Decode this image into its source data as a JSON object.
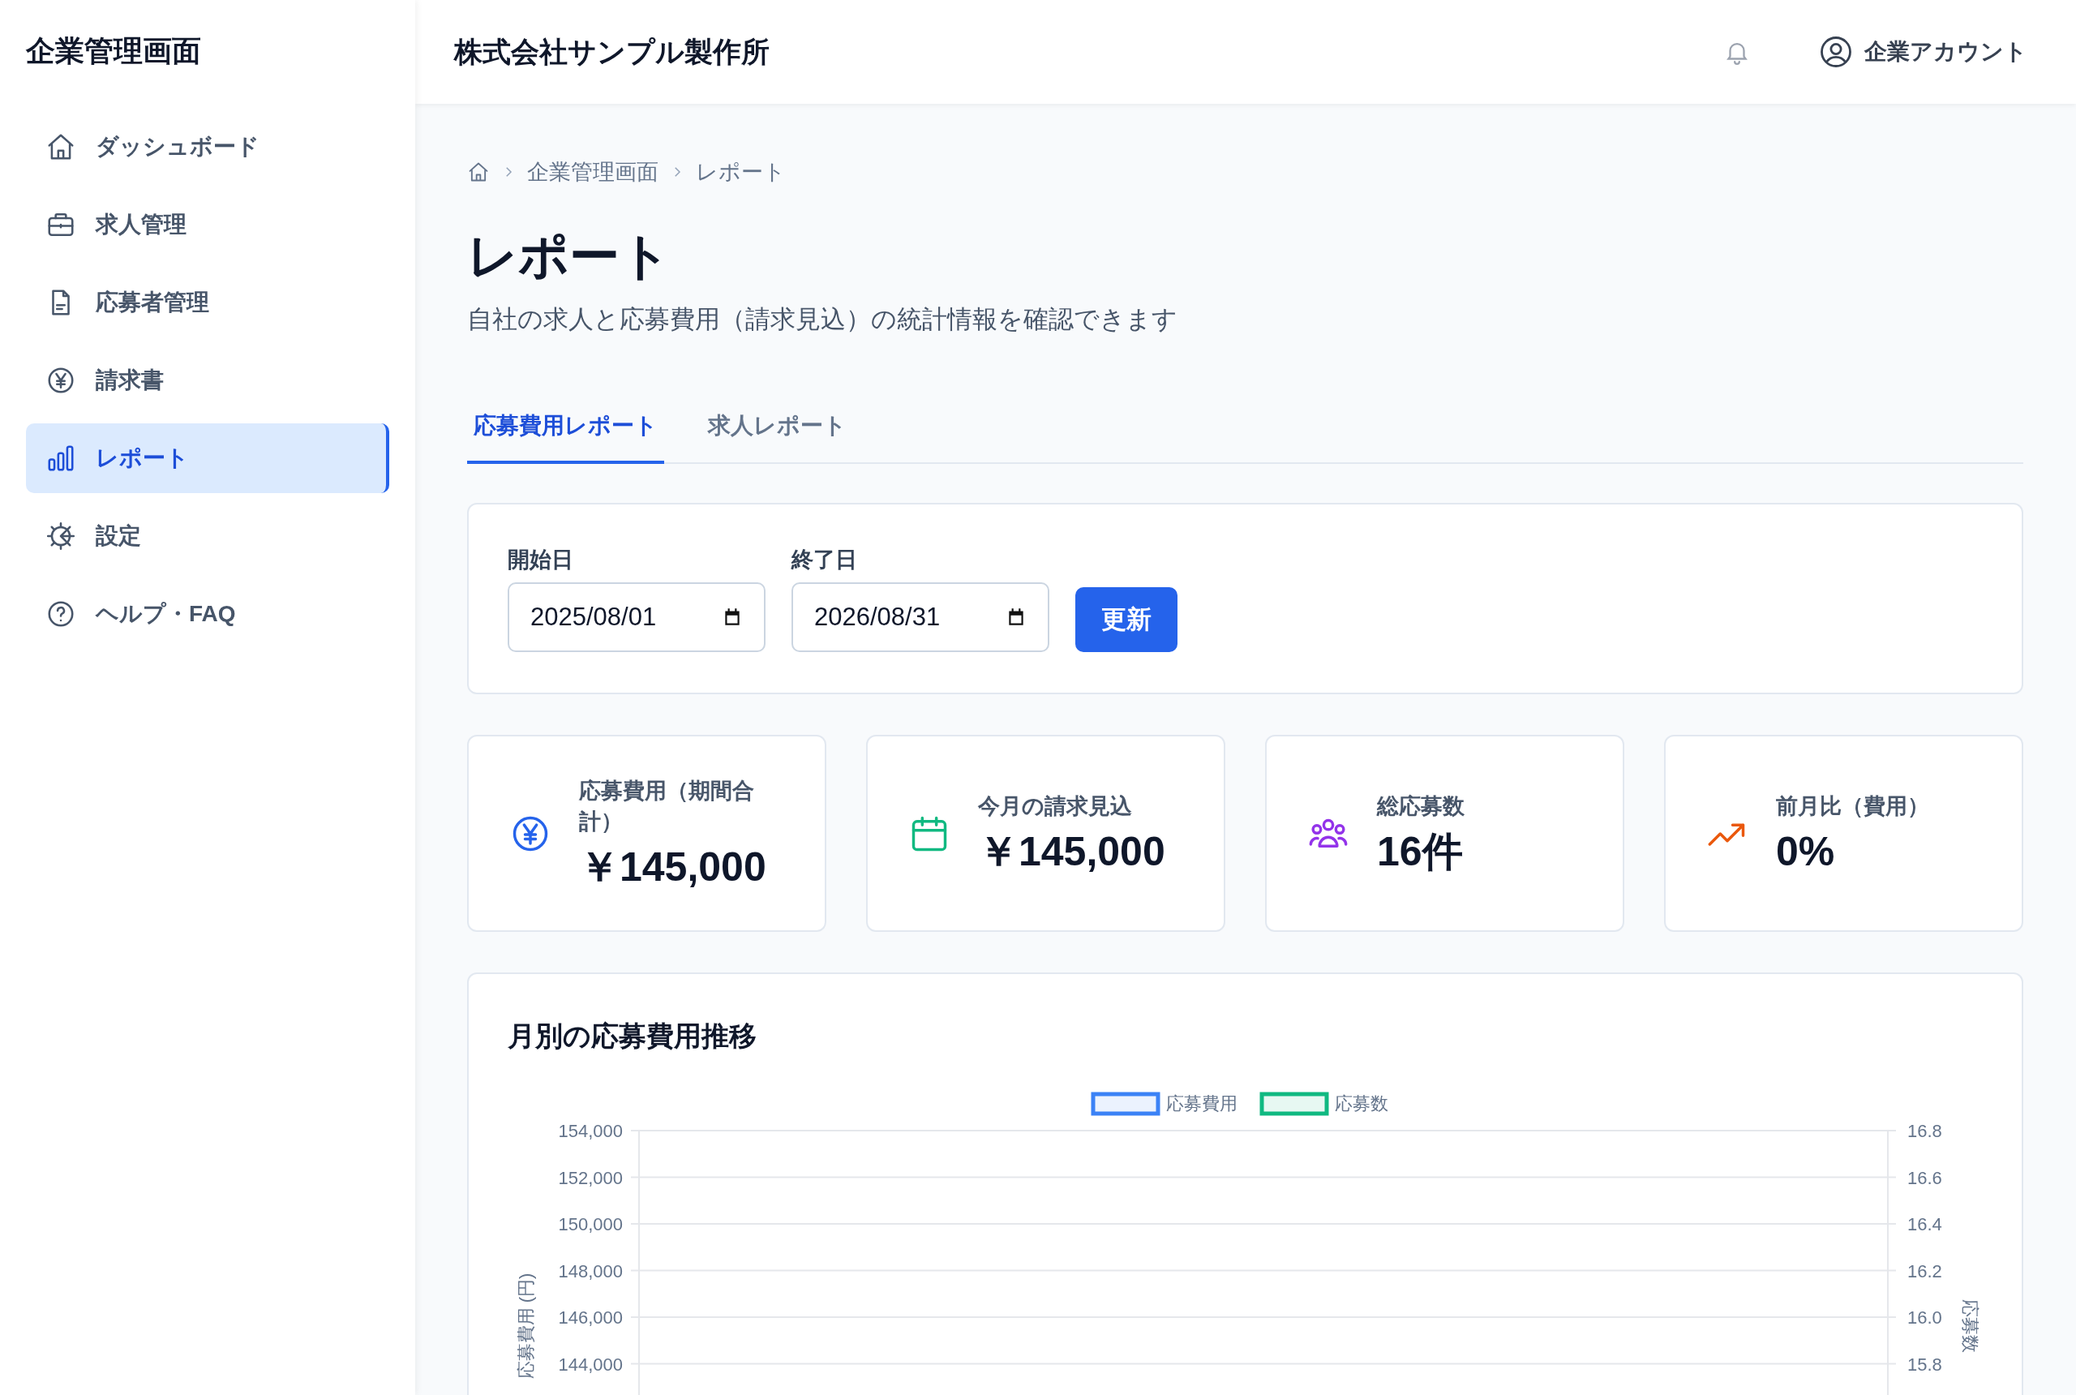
{
  "sidebar": {
    "title": "企業管理画面",
    "items": [
      {
        "label": "ダッシュボード",
        "selected": false
      },
      {
        "label": "求人管理",
        "selected": false
      },
      {
        "label": "応募者管理",
        "selected": false
      },
      {
        "label": "請求書",
        "selected": false
      },
      {
        "label": "レポート",
        "selected": true
      },
      {
        "label": "設定",
        "selected": false
      },
      {
        "label": "ヘルプ・FAQ",
        "selected": false
      }
    ]
  },
  "header": {
    "company": "株式会社サンプル製作所",
    "account": "企業アカウント"
  },
  "breadcrumb": [
    "企業管理画面",
    "レポート"
  ],
  "page": {
    "title": "レポート",
    "subtitle": "自社の求人と応募費用（請求見込）の統計情報を確認できます"
  },
  "tabs": [
    {
      "label": "応募費用レポート",
      "selected": true
    },
    {
      "label": "求人レポート",
      "selected": false
    }
  ],
  "filter": {
    "fields": [
      {
        "label": "開始日",
        "value": "2025/08/01"
      },
      {
        "label": "終了日",
        "value": "2026/08/31"
      }
    ],
    "button": "更新"
  },
  "stats": [
    {
      "color": "#2563eb",
      "label": "応募費用（期間合計）",
      "value": "￥145,000"
    },
    {
      "color": "#10b981",
      "label": "今月の請求見込",
      "value": "￥145,000"
    },
    {
      "color": "#9333ea",
      "label": "総応募数",
      "value": "16件"
    },
    {
      "color": "#ea580c",
      "label": "前月比（費用）",
      "value": "0%"
    }
  ],
  "chart_card": {
    "title": "月別の応募費用推移",
    "chart_data": {
      "type": "line",
      "ylabel": "応募費用 (円)",
      "ylim": [
        144000,
        154000
      ],
      "grid": true,
      "yticks": [
        {
          "value": 154000,
          "label": "154,000"
        },
        {
          "value": 152000,
          "label": "152,000"
        },
        {
          "value": 150000,
          "label": "150,000"
        },
        {
          "value": 148000,
          "label": "148,000"
        },
        {
          "value": 146000,
          "label": "146,000"
        },
        {
          "value": 144000,
          "label": "144,000"
        }
      ],
      "series": [
        {
          "name": "応募費用",
          "color": "#3b82f6"
        },
        {
          "name": "応募数",
          "color": "#10b981"
        }
      ]
    },
    "right_axis": {
      "label": "応募数",
      "ticks": [
        "16.8",
        "16.6",
        "16.4",
        "16.2",
        "16.0",
        "15.8"
      ]
    }
  }
}
